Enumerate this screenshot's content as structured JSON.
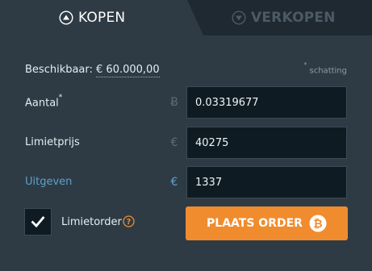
{
  "tabs": {
    "buy_label": "KOPEN",
    "sell_label": "VERKOPEN",
    "buy_icon": "arrow-up-circle-icon",
    "sell_icon": "arrow-down-circle-icon"
  },
  "balance": {
    "label": "Beschikbaar: ",
    "amount": "€ 60.000,00",
    "estimate_note": "schatting",
    "estimate_marker": "*"
  },
  "form": {
    "amount": {
      "label": "Aantal",
      "required_marker": "*",
      "currency_symbol": "Ƀ",
      "value": "0.03319677"
    },
    "limit_price": {
      "label": "Limietprijs",
      "currency_symbol": "€",
      "value": "40275"
    },
    "spend": {
      "label": "Uitgeven",
      "currency_symbol": "€",
      "value": "1337"
    }
  },
  "limit_order": {
    "label": "Limietorder",
    "checked": true,
    "help_icon": "question-circle-icon"
  },
  "actions": {
    "place_order_label": "PLAATS ORDER",
    "place_order_icon": "bitcoin-icon"
  },
  "colors": {
    "panel": "#2e3b45",
    "inactive_tab": "#1f2932",
    "input_bg": "#0f1b22",
    "accent": "#f08c2e",
    "link_blue": "#5f9fcc"
  }
}
